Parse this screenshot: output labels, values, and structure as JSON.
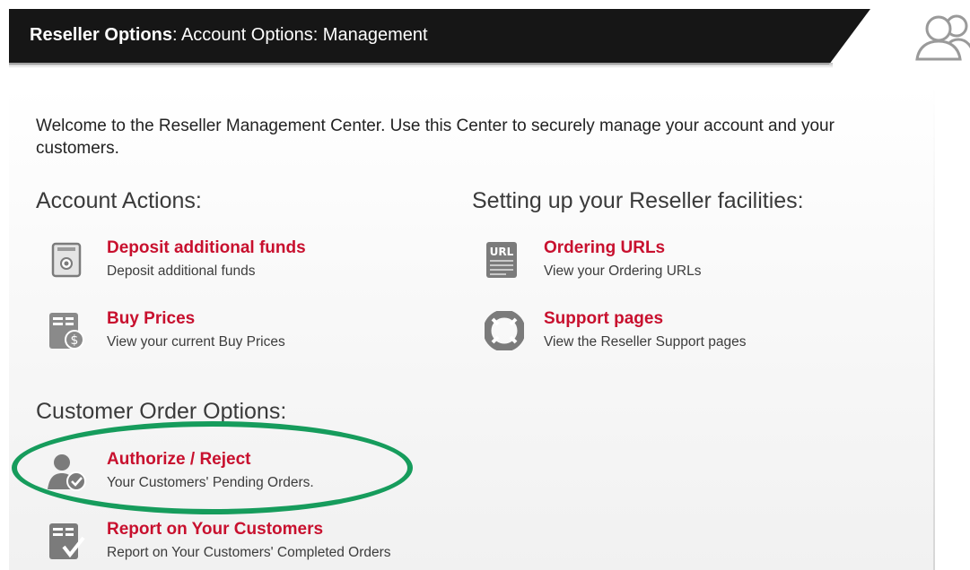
{
  "header": {
    "title_bold": "Reseller Options",
    "title_rest": ": Account Options: Management"
  },
  "intro": "Welcome to the Reseller Management Center. Use this Center to securely manage your account and your customers.",
  "account_actions": {
    "heading": "Account Actions:",
    "items": [
      {
        "title": "Deposit additional funds",
        "desc": "Deposit additional funds",
        "icon": "safe-icon"
      },
      {
        "title": "Buy Prices",
        "desc": "View your current Buy Prices",
        "icon": "price-list-icon"
      }
    ]
  },
  "reseller_facilities": {
    "heading": "Setting up your Reseller facilities:",
    "items": [
      {
        "title": "Ordering URLs",
        "desc": "View your Ordering URLs",
        "icon": "url-document-icon"
      },
      {
        "title": "Support pages",
        "desc": "View the Reseller Support pages",
        "icon": "lifebuoy-icon"
      }
    ]
  },
  "customer_orders": {
    "heading": "Customer Order Options:",
    "items": [
      {
        "title": "Authorize / Reject",
        "desc": "Your Customers' Pending Orders.",
        "icon": "user-check-icon"
      },
      {
        "title": "Report on Your Customers",
        "desc": "Report on Your Customers' Completed Orders",
        "icon": "report-check-icon"
      }
    ]
  },
  "colors": {
    "link_red": "#c8102e",
    "header_bg": "#161616",
    "highlight_green": "#169c5c",
    "icon_gray": "#7b7b7b"
  }
}
